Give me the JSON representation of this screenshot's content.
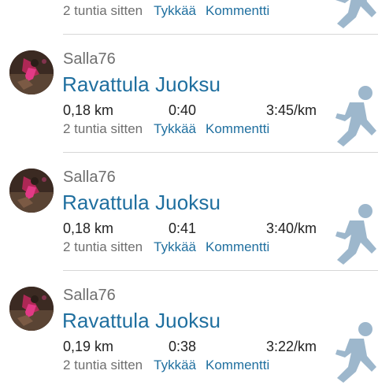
{
  "feed": {
    "entries": [
      {
        "username": "",
        "activity_title": "",
        "distance": "",
        "duration": "",
        "pace": "",
        "time_ago": "2 tuntia sitten",
        "like_label": "Tykkää",
        "comment_label": "Kommentti",
        "icon": "runner-icon"
      },
      {
        "username": "Salla76",
        "activity_title": "Ravattula Juoksu",
        "distance": "0,18 km",
        "duration": "0:40",
        "pace": "3:45/km",
        "time_ago": "2 tuntia sitten",
        "like_label": "Tykkää",
        "comment_label": "Kommentti",
        "icon": "runner-icon"
      },
      {
        "username": "Salla76",
        "activity_title": "Ravattula Juoksu",
        "distance": "0,18 km",
        "duration": "0:41",
        "pace": "3:40/km",
        "time_ago": "2 tuntia sitten",
        "like_label": "Tykkää",
        "comment_label": "Kommentti",
        "icon": "runner-icon"
      },
      {
        "username": "Salla76",
        "activity_title": "Ravattula Juoksu",
        "distance": "0,19 km",
        "duration": "0:38",
        "pace": "3:22/km",
        "time_ago": "2 tuntia sitten",
        "like_label": "Tykkää",
        "comment_label": "Kommentti",
        "icon": "runner-icon"
      }
    ]
  },
  "colors": {
    "link": "#1f6f9f",
    "muted_text": "#6f6f6f",
    "body_text": "#222222",
    "icon": "#9db7cc",
    "divider": "#d7d7d7"
  }
}
